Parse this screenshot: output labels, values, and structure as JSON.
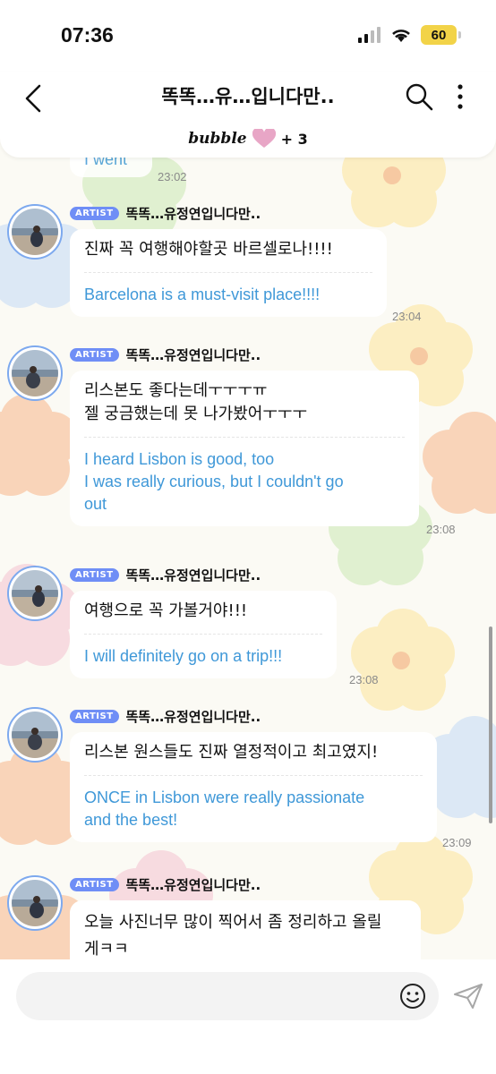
{
  "status_bar": {
    "time": "07:36",
    "battery": "60"
  },
  "header": {
    "title": "똑똑…유…입니다만..",
    "bubble_brand": "bubble",
    "bubble_count": "+ 3"
  },
  "messages": [
    {
      "korean": "",
      "english": "I went",
      "time": "23:02"
    },
    {
      "badge": "ARTIST",
      "sender": "똑똑…유정연입니다만..",
      "korean": "진짜 꼭 여행해야할곳 바르셀로나!!!!",
      "english": "Barcelona is a must-visit place!!!!",
      "time": "23:04"
    },
    {
      "badge": "ARTIST",
      "sender": "똑똑…유정연입니다만..",
      "korean": "리스본도 좋다는데ㅜㅜㅜㅠ\n젤 궁금했는데 못 나가봤어ㅜㅜㅜ",
      "english": "I heard Lisbon is good, too\nI was really curious, but I couldn't go\nout",
      "time": "23:08"
    },
    {
      "badge": "ARTIST",
      "sender": "똑똑…유정연입니다만..",
      "korean": "여행으로 꼭 가볼거야!!!",
      "english": "I will definitely go on a trip!!!",
      "time": "23:08"
    },
    {
      "badge": "ARTIST",
      "sender": "똑똑…유정연입니다만..",
      "korean": "리스본 원스들도 진짜 열정적이고 최고였지!",
      "english": "ONCE in Lisbon were really passionate\nand the best!",
      "time": "23:09"
    },
    {
      "badge": "ARTIST",
      "sender": "똑똑…유정연입니다만..",
      "korean": "오늘 사진너무 많이 찍어서 좀 정리하고 올릴\n게ㅋㅋ",
      "english": "",
      "time": ""
    }
  ],
  "input": {
    "placeholder": ""
  },
  "icons": {
    "back": "chevron-left-icon",
    "search": "search-icon",
    "more": "more-vertical-icon",
    "heart": "heart-icon",
    "emoji": "smiley-icon",
    "send": "send-icon"
  },
  "colors": {
    "accent_blue": "#6f8ef6",
    "translation_text": "#3f98d8",
    "battery": "#f2d348"
  }
}
